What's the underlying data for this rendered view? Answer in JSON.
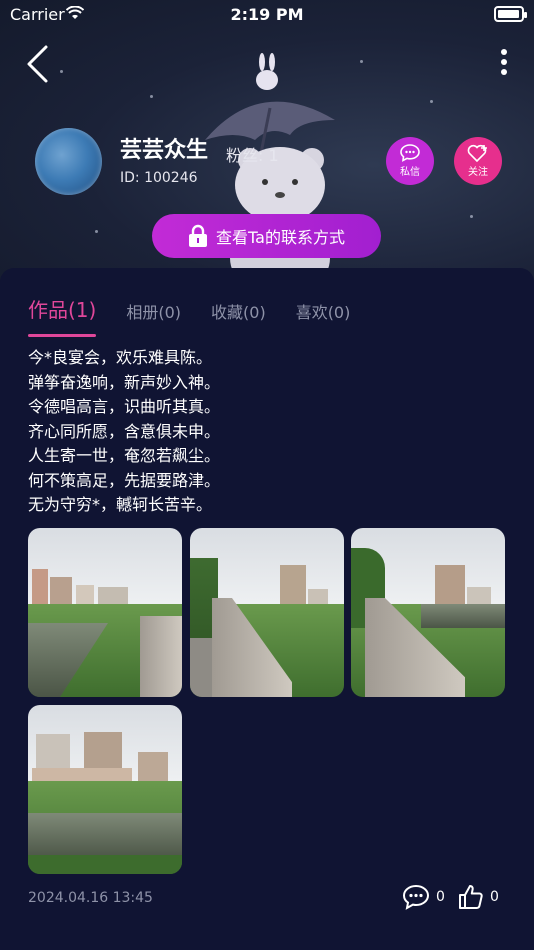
{
  "status_bar": {
    "carrier": "Carrier",
    "time": "2:19 PM",
    "battery_level": 0.95
  },
  "profile": {
    "name": "芸芸众生",
    "fans": "粉丝: 1",
    "id": "ID: 100246",
    "message_label": "私信",
    "follow_label": "关注",
    "contact_label": "查看Ta的联系方式"
  },
  "tabs": [
    {
      "label": "作品(1)",
      "active": true
    },
    {
      "label": "相册(0)",
      "active": false
    },
    {
      "label": "收藏(0)",
      "active": false
    },
    {
      "label": "喜欢(0)",
      "active": false
    }
  ],
  "post": {
    "lines": [
      "今*良宴会，欢乐难具陈。",
      "弹筝奋逸响，新声妙入神。",
      "令德唱高言，识曲听其真。",
      "齐心同所愿，含意俱未申。",
      "人生寄一世，奄忽若飙尘。",
      "何不策高足，先据要路津。",
      "无为守穷*，轗轲长苦辛。"
    ],
    "photos": [
      "river-bridge-photo",
      "riverside-railing-photo",
      "river-railing-photo",
      "river-buildings-photo"
    ],
    "date": "2024.04.16 13:45",
    "comment_count": "0",
    "like_count": "0"
  },
  "colors": {
    "accent": "#e0479a",
    "purple": "#c22bd6",
    "pink": "#e62f8d",
    "panel": "#101433"
  },
  "icons": [
    "wifi-icon",
    "back-arrow-icon",
    "more-dots-icon",
    "chat-bubble-icon",
    "heart-plus-icon",
    "lock-icon",
    "comment-icon",
    "thumbs-up-icon"
  ]
}
